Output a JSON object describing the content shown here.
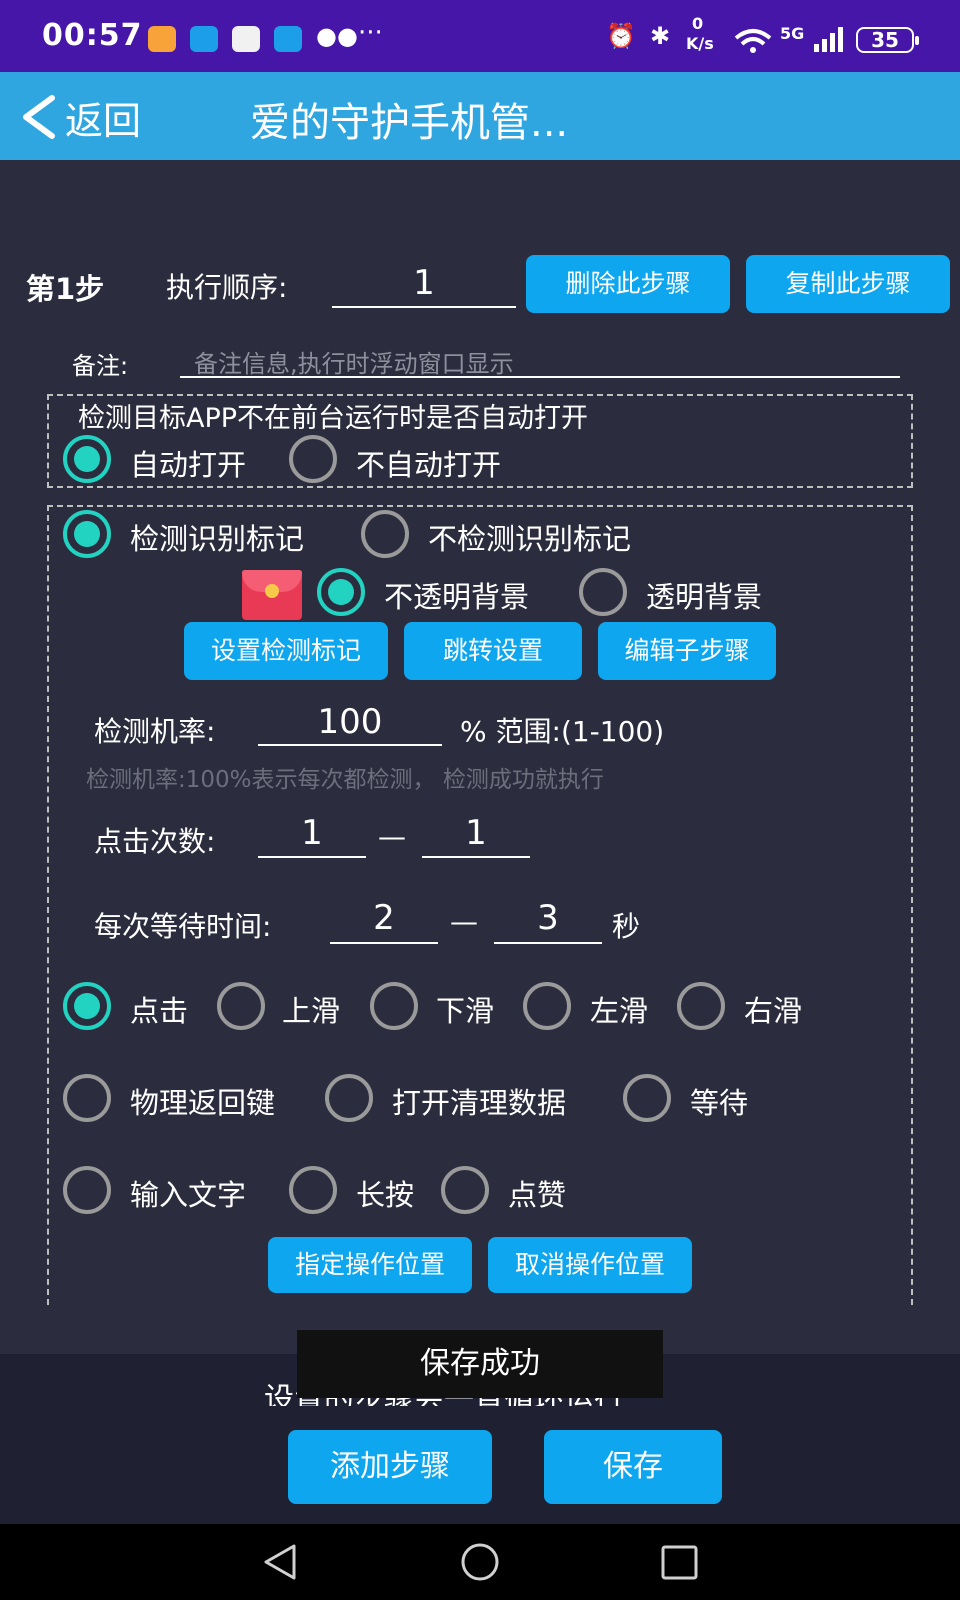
{
  "status_bar": {
    "time": "00:57",
    "speed_top": "0",
    "speed_unit": "K/s",
    "network": "5G",
    "battery": "35",
    "more": "···"
  },
  "header": {
    "back_label": "返回",
    "title": "爱的守护手机管..."
  },
  "step": {
    "label": "第1步",
    "order_label": "执行顺序:",
    "order_value": "1",
    "delete_button": "删除此步骤",
    "copy_button": "复制此步骤",
    "note_label": "备注:",
    "note_placeholder": "备注信息,执行时浮动窗口显示"
  },
  "auto_open": {
    "title": "检测目标APP不在前台运行时是否自动打开",
    "options": [
      "自动打开",
      "不自动打开"
    ],
    "selected": 0
  },
  "detect": {
    "options": [
      "检测识别标记",
      "不检测识别标记"
    ],
    "selected": 0,
    "bg_options": [
      "不透明背景",
      "透明背景"
    ],
    "bg_selected": 0,
    "buttons": [
      "设置检测标记",
      "跳转设置",
      "编辑子步骤"
    ],
    "rate_label": "检测机率:",
    "rate_value": "100",
    "rate_range": "% 范围:(1-100)",
    "rate_hint": "检测机率:100%表示每次都检测， 检测成功就执行",
    "clicks_label": "点击次数:",
    "clicks_min": "1",
    "clicks_max": "1",
    "dash": "—",
    "wait_label": "每次等待时间:",
    "wait_min": "2",
    "wait_max": "3",
    "wait_unit": "秒"
  },
  "actions": {
    "row1": [
      "点击",
      "上滑",
      "下滑",
      "左滑",
      "右滑"
    ],
    "row2": [
      "物理返回键",
      "打开清理数据",
      "等待"
    ],
    "row3": [
      "输入文字",
      "长按",
      "点赞"
    ],
    "selected": "点击",
    "position_buttons": [
      "指定操作位置",
      "取消操作位置"
    ]
  },
  "bottom": {
    "hidden_text": "设置的步骤会一直循环运行",
    "add_button": "添加步骤",
    "save_button": "保存",
    "toast": "保存成功"
  },
  "colors": {
    "status_bar": "#4616a8",
    "header": "#30a6e0",
    "background": "#2b2d3e",
    "button": "#0ea6ee",
    "radio_selected": "#22d3c2"
  }
}
